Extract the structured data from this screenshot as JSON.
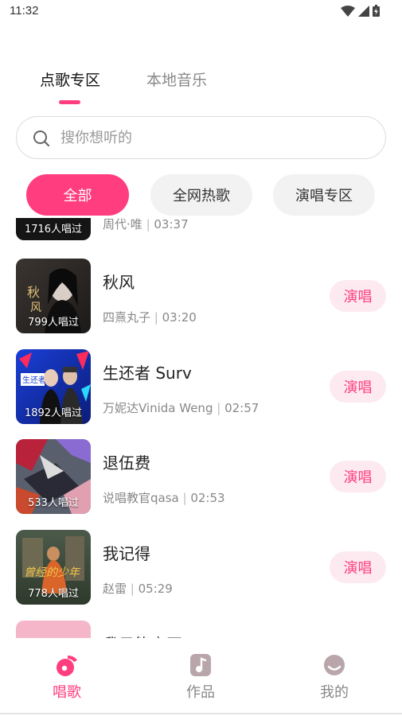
{
  "status_bar": {
    "time": "11:32"
  },
  "tabs": [
    {
      "label": "点歌专区",
      "active": true
    },
    {
      "label": "本地音乐",
      "active": false
    }
  ],
  "search": {
    "placeholder": "搜你想听的",
    "value": ""
  },
  "filters": [
    {
      "label": "全部",
      "selected": true
    },
    {
      "label": "全网热歌",
      "selected": false
    },
    {
      "label": "演唱专区",
      "selected": false
    }
  ],
  "songs": [
    {
      "title": "",
      "artist": "周代·唯",
      "duration": "03:37",
      "sung_count": "1716人唱过",
      "action": ""
    },
    {
      "title": "秋风",
      "artist": "四熹丸子",
      "duration": "03:20",
      "sung_count": "799人唱过",
      "action": "演唱"
    },
    {
      "title": "生还者 Surv",
      "artist": "万妮达Vinida Weng",
      "duration": "02:57",
      "sung_count": "1892人唱过",
      "action": "演唱"
    },
    {
      "title": "退伍费",
      "artist": "说唱教官qasa",
      "duration": "02:53",
      "sung_count": "533人唱过",
      "action": "演唱"
    },
    {
      "title": "我记得",
      "artist": "赵雷",
      "duration": "05:29",
      "sung_count": "778人唱过",
      "action": "演唱"
    },
    {
      "title": "我只能离开",
      "artist": "",
      "duration": "",
      "sung_count": "",
      "action": ""
    }
  ],
  "bottom_nav": [
    {
      "label": "唱歌",
      "icon": "music-note-icon",
      "active": true
    },
    {
      "label": "作品",
      "icon": "works-icon",
      "active": false
    },
    {
      "label": "我的",
      "icon": "profile-icon",
      "active": false
    }
  ],
  "colors": {
    "accent": "#ff3d7f",
    "accent_light": "#fdeaf1",
    "chip_gray": "#f2f2f2",
    "text_gray": "#888888"
  }
}
